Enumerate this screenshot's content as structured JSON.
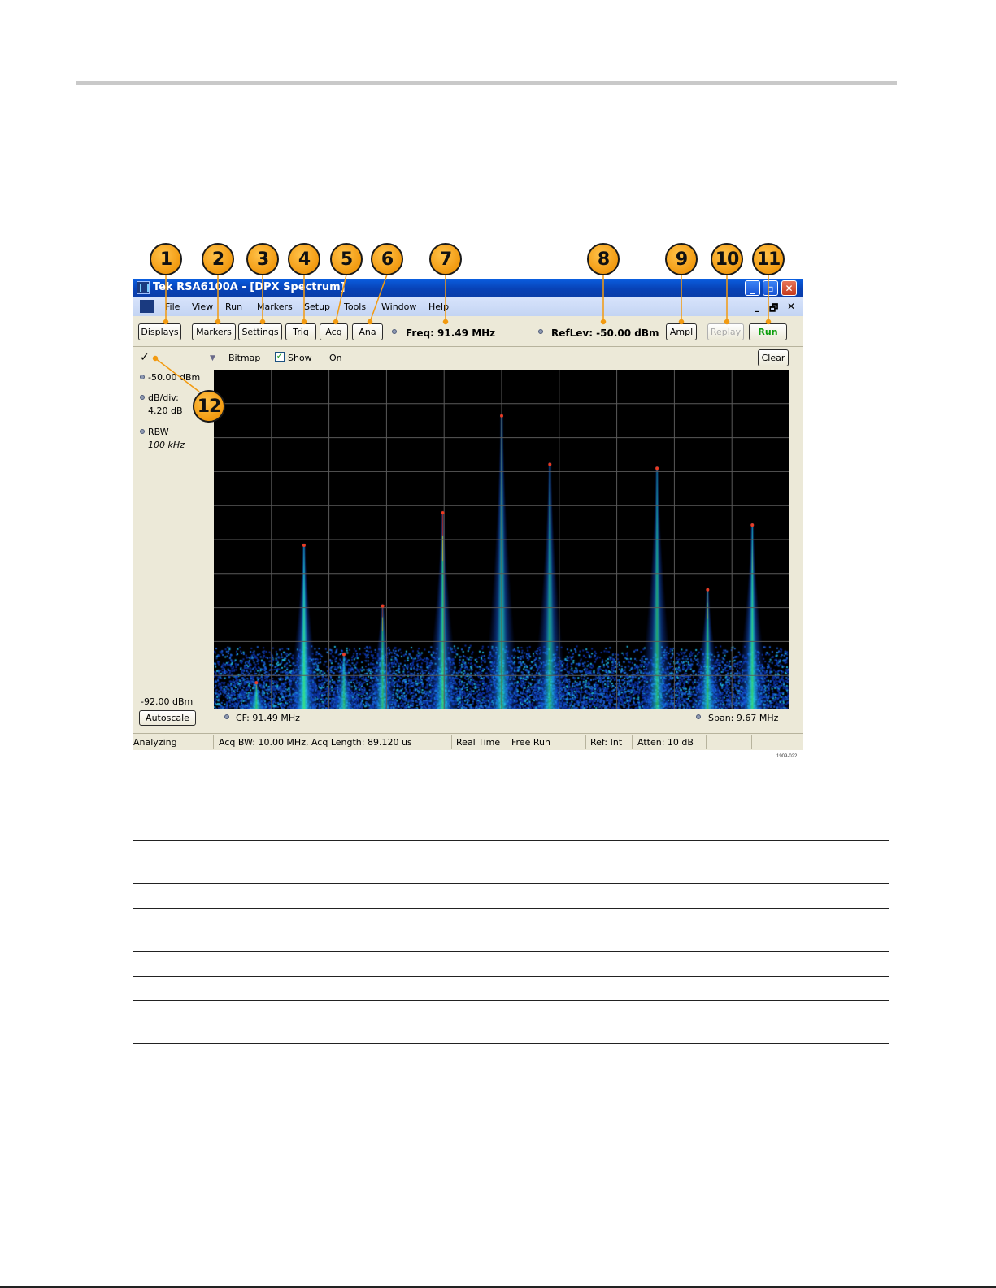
{
  "callouts": [
    "1",
    "2",
    "3",
    "4",
    "5",
    "6",
    "7",
    "8",
    "9",
    "10",
    "11",
    "12"
  ],
  "window": {
    "title": "Tek RSA6100A - [DPX Spectrum]",
    "controls": {
      "minimize": "_",
      "restore": "▫",
      "close": "✕"
    }
  },
  "menu": {
    "items": [
      "File",
      "View",
      "Run",
      "Markers",
      "Setup",
      "Tools",
      "Window",
      "Help"
    ],
    "mdi": {
      "minimize": "_",
      "restore": "🗗",
      "close": "✕"
    }
  },
  "toolbar": {
    "displays": "Displays",
    "markers": "Markers",
    "settings": "Settings",
    "trig": "Trig",
    "acq": "Acq",
    "ana": "Ana",
    "freq": "Freq: 91.49 MHz",
    "reflev": "RefLev: -50.00 dBm",
    "ampl": "Ampl",
    "replay": "Replay",
    "run": "Run"
  },
  "trace": {
    "check": "✓",
    "arrow": "▼",
    "name": "Bitmap",
    "show_label": "Show",
    "show_checked": "✓",
    "state": "On",
    "clear": "Clear"
  },
  "sidebar": {
    "ref_level": "-50.00 dBm",
    "dbdiv_label": "dB/div:",
    "dbdiv_value": "4.20 dB",
    "rbw_label": "RBW",
    "rbw_value": "100 kHz",
    "bottom_level": "-92.00 dBm",
    "autoscale": "Autoscale"
  },
  "axis": {
    "cf": "CF: 91.49 MHz",
    "span": "Span: 9.67 MHz"
  },
  "status": [
    "Analyzing",
    "Acq BW: 10.00 MHz, Acq Length: 89.120 us",
    "Real Time",
    "Free Run",
    "Ref: Int",
    "Atten: 10 dB"
  ],
  "figure_id": "1909-022",
  "chart_data": {
    "type": "heatmap",
    "x_center_mhz": 91.49,
    "span_mhz": 9.67,
    "ylim_dbm": [
      -92.0,
      -50.0
    ],
    "db_per_div": 4.2,
    "grid": true,
    "peaks": [
      {
        "freq_mhz": 87.37,
        "level_dbm": -88.5
      },
      {
        "freq_mhz": 88.17,
        "level_dbm": -71.5
      },
      {
        "freq_mhz": 88.84,
        "level_dbm": -85.0
      },
      {
        "freq_mhz": 89.49,
        "level_dbm": -79.0
      },
      {
        "freq_mhz": 90.5,
        "level_dbm": -67.5
      },
      {
        "freq_mhz": 91.49,
        "level_dbm": -55.5
      },
      {
        "freq_mhz": 92.3,
        "level_dbm": -61.5
      },
      {
        "freq_mhz": 94.1,
        "level_dbm": -62.0
      },
      {
        "freq_mhz": 94.95,
        "level_dbm": -77.0
      },
      {
        "freq_mhz": 95.7,
        "level_dbm": -69.0
      }
    ]
  }
}
